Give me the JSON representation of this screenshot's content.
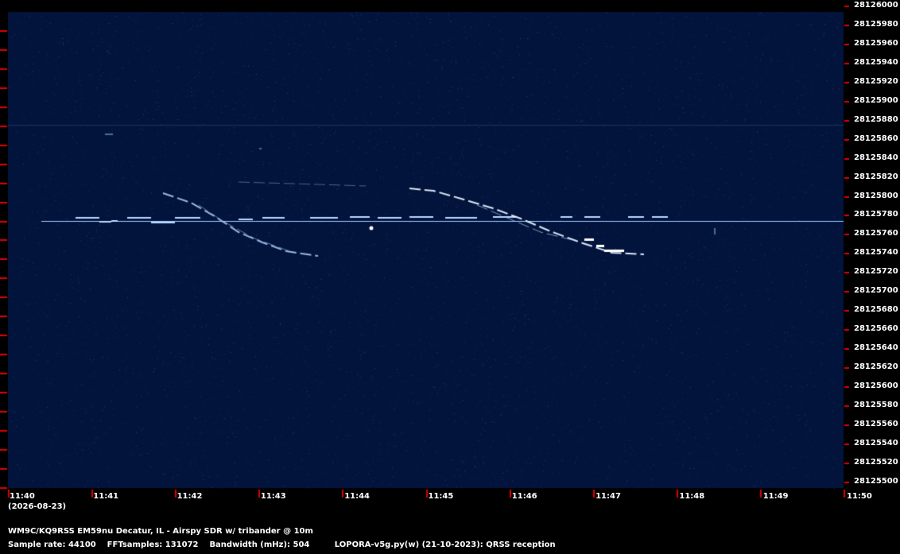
{
  "colors": {
    "background": "#03143c",
    "frame": "#000000",
    "tick": "#e00000",
    "signal": "#9cc8ff",
    "text": "#ffffff"
  },
  "frequency_labels": [
    "28126000",
    "28125980",
    "28125960",
    "28125940",
    "28125920",
    "28125900",
    "28125880",
    "28125860",
    "28125840",
    "28125820",
    "28125800",
    "28125780",
    "28125760",
    "28125740",
    "28125720",
    "28125700",
    "28125680",
    "28125660",
    "28125640",
    "28125620",
    "28125600",
    "28125580",
    "28125560",
    "28125540",
    "28125520",
    "28125500"
  ],
  "time_labels": [
    "11:40",
    "11:41",
    "11:42",
    "11:43",
    "11:44",
    "11:45",
    "11:46",
    "11:47",
    "11:48",
    "11:49",
    "11:50"
  ],
  "date_label": "(2026-08-23)",
  "footer": {
    "station": "WM9C/KQ9RSS EM59nu Decatur, IL - Airspy SDR w/ tribander @ 10m",
    "sample_rate": "Sample rate: 44100",
    "fft_samples": "FFTsamples: 131072",
    "bandwidth": "Bandwidth (mHz): 504",
    "software": "LOPORA-v5g.py(w) (21-10-2023): QRSS reception"
  }
}
